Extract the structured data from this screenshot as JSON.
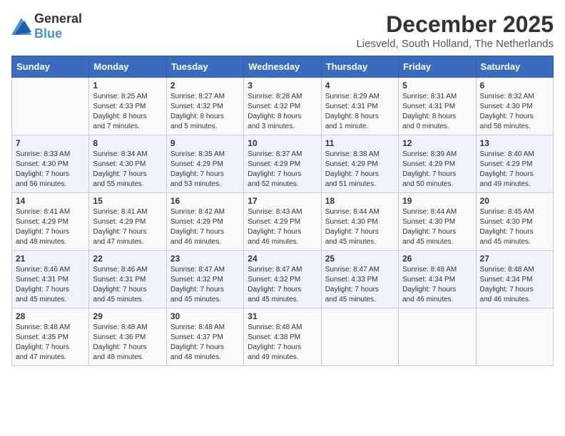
{
  "logo": {
    "general": "General",
    "blue": "Blue"
  },
  "title": "December 2025",
  "location": "Liesveld, South Holland, The Netherlands",
  "days_of_week": [
    "Sunday",
    "Monday",
    "Tuesday",
    "Wednesday",
    "Thursday",
    "Friday",
    "Saturday"
  ],
  "weeks": [
    [
      {
        "day": "",
        "info": ""
      },
      {
        "day": "1",
        "info": "Sunrise: 8:25 AM\nSunset: 4:33 PM\nDaylight: 8 hours\nand 7 minutes."
      },
      {
        "day": "2",
        "info": "Sunrise: 8:27 AM\nSunset: 4:32 PM\nDaylight: 8 hours\nand 5 minutes."
      },
      {
        "day": "3",
        "info": "Sunrise: 8:28 AM\nSunset: 4:32 PM\nDaylight: 8 hours\nand 3 minutes."
      },
      {
        "day": "4",
        "info": "Sunrise: 8:29 AM\nSunset: 4:31 PM\nDaylight: 8 hours\nand 1 minute."
      },
      {
        "day": "5",
        "info": "Sunrise: 8:31 AM\nSunset: 4:31 PM\nDaylight: 8 hours\nand 0 minutes."
      },
      {
        "day": "6",
        "info": "Sunrise: 8:32 AM\nSunset: 4:30 PM\nDaylight: 7 hours\nand 58 minutes."
      }
    ],
    [
      {
        "day": "7",
        "info": "Sunrise: 8:33 AM\nSunset: 4:30 PM\nDaylight: 7 hours\nand 56 minutes."
      },
      {
        "day": "8",
        "info": "Sunrise: 8:34 AM\nSunset: 4:30 PM\nDaylight: 7 hours\nand 55 minutes."
      },
      {
        "day": "9",
        "info": "Sunrise: 8:35 AM\nSunset: 4:29 PM\nDaylight: 7 hours\nand 53 minutes."
      },
      {
        "day": "10",
        "info": "Sunrise: 8:37 AM\nSunset: 4:29 PM\nDaylight: 7 hours\nand 52 minutes."
      },
      {
        "day": "11",
        "info": "Sunrise: 8:38 AM\nSunset: 4:29 PM\nDaylight: 7 hours\nand 51 minutes."
      },
      {
        "day": "12",
        "info": "Sunrise: 8:39 AM\nSunset: 4:29 PM\nDaylight: 7 hours\nand 50 minutes."
      },
      {
        "day": "13",
        "info": "Sunrise: 8:40 AM\nSunset: 4:29 PM\nDaylight: 7 hours\nand 49 minutes."
      }
    ],
    [
      {
        "day": "14",
        "info": "Sunrise: 8:41 AM\nSunset: 4:29 PM\nDaylight: 7 hours\nand 48 minutes."
      },
      {
        "day": "15",
        "info": "Sunrise: 8:41 AM\nSunset: 4:29 PM\nDaylight: 7 hours\nand 47 minutes."
      },
      {
        "day": "16",
        "info": "Sunrise: 8:42 AM\nSunset: 4:29 PM\nDaylight: 7 hours\nand 46 minutes."
      },
      {
        "day": "17",
        "info": "Sunrise: 8:43 AM\nSunset: 4:29 PM\nDaylight: 7 hours\nand 46 minutes."
      },
      {
        "day": "18",
        "info": "Sunrise: 8:44 AM\nSunset: 4:30 PM\nDaylight: 7 hours\nand 45 minutes."
      },
      {
        "day": "19",
        "info": "Sunrise: 8:44 AM\nSunset: 4:30 PM\nDaylight: 7 hours\nand 45 minutes."
      },
      {
        "day": "20",
        "info": "Sunrise: 8:45 AM\nSunset: 4:30 PM\nDaylight: 7 hours\nand 45 minutes."
      }
    ],
    [
      {
        "day": "21",
        "info": "Sunrise: 8:46 AM\nSunset: 4:31 PM\nDaylight: 7 hours\nand 45 minutes."
      },
      {
        "day": "22",
        "info": "Sunrise: 8:46 AM\nSunset: 4:31 PM\nDaylight: 7 hours\nand 45 minutes."
      },
      {
        "day": "23",
        "info": "Sunrise: 8:47 AM\nSunset: 4:32 PM\nDaylight: 7 hours\nand 45 minutes."
      },
      {
        "day": "24",
        "info": "Sunrise: 8:47 AM\nSunset: 4:32 PM\nDaylight: 7 hours\nand 45 minutes."
      },
      {
        "day": "25",
        "info": "Sunrise: 8:47 AM\nSunset: 4:33 PM\nDaylight: 7 hours\nand 45 minutes."
      },
      {
        "day": "26",
        "info": "Sunrise: 8:48 AM\nSunset: 4:34 PM\nDaylight: 7 hours\nand 46 minutes."
      },
      {
        "day": "27",
        "info": "Sunrise: 8:48 AM\nSunset: 4:34 PM\nDaylight: 7 hours\nand 46 minutes."
      }
    ],
    [
      {
        "day": "28",
        "info": "Sunrise: 8:48 AM\nSunset: 4:35 PM\nDaylight: 7 hours\nand 47 minutes."
      },
      {
        "day": "29",
        "info": "Sunrise: 8:48 AM\nSunset: 4:36 PM\nDaylight: 7 hours\nand 48 minutes."
      },
      {
        "day": "30",
        "info": "Sunrise: 8:48 AM\nSunset: 4:37 PM\nDaylight: 7 hours\nand 48 minutes."
      },
      {
        "day": "31",
        "info": "Sunrise: 8:48 AM\nSunset: 4:38 PM\nDaylight: 7 hours\nand 49 minutes."
      },
      {
        "day": "",
        "info": ""
      },
      {
        "day": "",
        "info": ""
      },
      {
        "day": "",
        "info": ""
      }
    ]
  ]
}
